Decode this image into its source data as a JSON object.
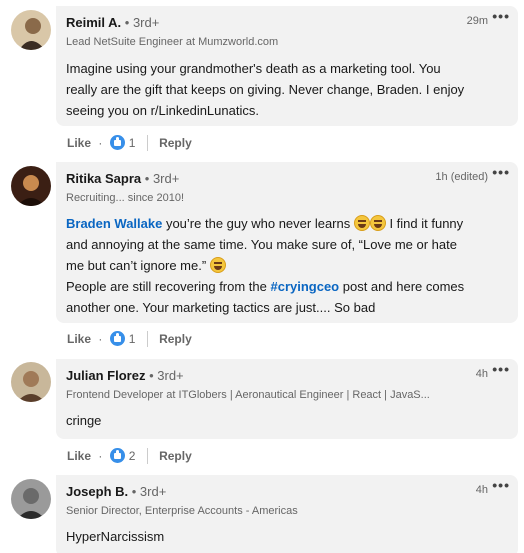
{
  "comments": [
    {
      "name": "Reimil A.",
      "degree": "• 3rd+",
      "headline": "Lead NetSuite Engineer at Mumzworld.com",
      "time": "29m",
      "more": "•••",
      "body": [
        "Imagine using your grandmother's death as a marketing tool. You",
        "really are the gift that keeps on giving. Never change, Braden. I enjoy",
        "seeing you on r/LinkedinLunatics."
      ],
      "like_label": "Like",
      "reaction_count": "1",
      "reply_label": "Reply",
      "avatar_colors": [
        "#d9c7a8",
        "#3a2c22"
      ]
    },
    {
      "name": "Ritika Sapra",
      "degree": "• 3rd+",
      "headline": "Recruiting... since 2010!",
      "time": "1h (edited)",
      "more": "•••",
      "mention": "Braden Wallake",
      "line1_rest": " you’re the guy who never learns ",
      "line1_after": " I find it funny",
      "line2": "and annoying at the same time. You make sure of, “Love me or hate",
      "line3": "me but can’t ignore me.” ",
      "line4_pre": "People are still recovering from the ",
      "hashtag": "#cryingceo",
      "line4_post": " post and here comes",
      "line5": "another one. Your marketing tactics are just.... So bad",
      "like_label": "Like",
      "reaction_count": "1",
      "reply_label": "Reply",
      "avatar_colors": [
        "#3b1f14",
        "#c98a4f"
      ]
    },
    {
      "name": "Julian Florez",
      "degree": "• 3rd+",
      "headline": "Frontend Developer at ITGlobers | Aeronautical Engineer | React | JavaS...",
      "time": "4h",
      "more": "•••",
      "body": [
        "cringe"
      ],
      "like_label": "Like",
      "reaction_count": "2",
      "reply_label": "Reply",
      "avatar_colors": [
        "#c8b79a",
        "#5a3e2b"
      ]
    },
    {
      "name": "Joseph B.",
      "degree": "• 3rd+",
      "headline": "Senior Director, Enterprise Accounts - Americas",
      "time": "4h",
      "more": "•••",
      "body": [
        "HyperNarcissism"
      ],
      "avatar_colors": [
        "#9a9a9a",
        "#2b2b2b"
      ]
    }
  ],
  "colors": {
    "bubble": "#f2f2f2",
    "link": "#0a66c2",
    "muted": "#666666",
    "like_badge": "#378fe9"
  }
}
